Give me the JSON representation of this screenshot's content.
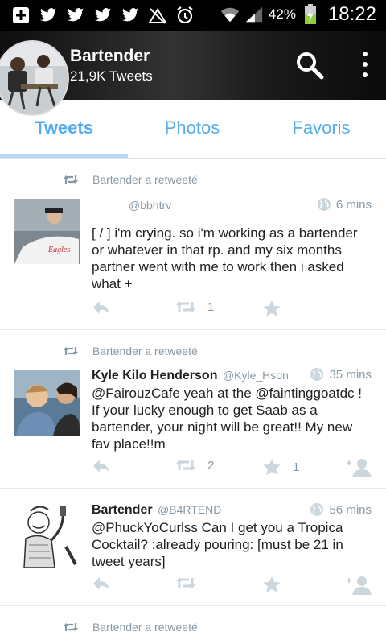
{
  "status_bar": {
    "battery": "42%",
    "time": "18:22",
    "left_icons": [
      "add-icon",
      "twitter-bird-icon",
      "twitter-bird-icon",
      "twitter-bird-icon",
      "twitter-bird-icon",
      "no-signal-icon",
      "alarm-icon"
    ],
    "right_icons": [
      "wifi-icon",
      "signal-icon",
      "battery-charging-icon"
    ]
  },
  "appbar": {
    "title": "Bartender",
    "subtitle": "21,9K Tweets"
  },
  "tabs": [
    {
      "label": "Tweets",
      "active": true
    },
    {
      "label": "Photos",
      "active": false
    },
    {
      "label": "Favoris",
      "active": false
    }
  ],
  "tweets": [
    {
      "retweet_label": "Bartender a retweeté",
      "name": "",
      "handle": "@bbhtrv",
      "time": "6 mins",
      "text": "[ / ] i'm crying. so i'm working as a bartender or whatever in that rp. and my six months partner went with me to work then i asked what +",
      "retweets": "1",
      "favorites": ""
    },
    {
      "retweet_label": "Bartender a retweeté",
      "name": "Kyle Kilo Henderson",
      "handle": "@Kyle_Hson",
      "time": "35 mins",
      "text": "@FairouzCafe yeah at the @faintinggoatdc ! If your lucky enough to get Saab as a bartender, your night will be great!! My new fav place!!m",
      "retweets": "2",
      "favorites": "1"
    },
    {
      "retweet_label": "",
      "name": "Bartender",
      "handle": "@B4RTEND",
      "time": "56 mins",
      "text": "@PhuckYoCurlss Can I get you a Tropica Cocktail? :already pouring: [must be 21 in tweet years]",
      "retweets": "",
      "favorites": ""
    },
    {
      "retweet_label": "Bartender a retweeté"
    }
  ],
  "colors": {
    "accent": "#55acee",
    "muted": "#8899a6",
    "text": "#222222"
  }
}
